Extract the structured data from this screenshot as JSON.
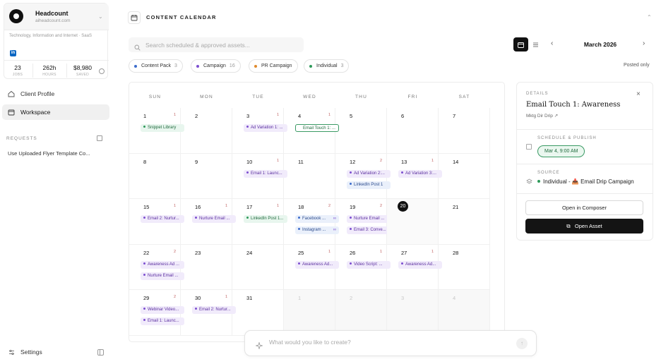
{
  "org": {
    "name": "Headcount",
    "domain": "aiheadcount.com",
    "industry": "Technology, Information and Internet · SaaS",
    "linkedin_badge": "in",
    "stats": [
      {
        "value": "23",
        "label": "JOBS"
      },
      {
        "value": "262h",
        "label": "HOURS"
      },
      {
        "value": "$8,980",
        "label": "SAVED"
      }
    ]
  },
  "nav": {
    "items": [
      {
        "label": "Client Profile",
        "icon": "home-icon",
        "active": false
      },
      {
        "label": "Workspace",
        "icon": "calendar-icon",
        "active": true
      }
    ]
  },
  "requests": {
    "label": "REQUESTS",
    "items": [
      "Use Uploaded Flyer Template Co..."
    ]
  },
  "settings_label": "Settings",
  "header": {
    "title": "CONTENT CALENDAR"
  },
  "search": {
    "placeholder": "Search scheduled & approved assets..."
  },
  "month": {
    "label": "March 2026",
    "prev": "‹",
    "next": "›"
  },
  "filters": [
    {
      "label": "Content Pack",
      "count": "3",
      "color": "#3c6ccc"
    },
    {
      "label": "Campaign",
      "count": "16",
      "color": "#7d4fd0"
    },
    {
      "label": "PR Campaign",
      "count": "",
      "color": "#e08a2c"
    },
    {
      "label": "Individual",
      "count": "3",
      "color": "#2e9a5a"
    }
  ],
  "posted_only": "Posted only",
  "weekdays": [
    "SUN",
    "MON",
    "TUE",
    "WED",
    "THU",
    "FRI",
    "SAT"
  ],
  "days": [
    {
      "d": "1",
      "c": "1",
      "events": [
        {
          "t": "Snippet Library",
          "k": "green"
        }
      ]
    },
    {
      "d": "2",
      "c": "",
      "events": []
    },
    {
      "d": "3",
      "c": "1",
      "events": [
        {
          "t": "Ad Variation 1: ...",
          "k": "purple"
        }
      ]
    },
    {
      "d": "4",
      "c": "1",
      "events": [
        {
          "t": "Email Touch 1: ...",
          "k": "selected"
        }
      ]
    },
    {
      "d": "5",
      "c": "",
      "events": []
    },
    {
      "d": "6",
      "c": "",
      "events": []
    },
    {
      "d": "7",
      "c": "",
      "events": []
    },
    {
      "d": "8",
      "c": "",
      "events": []
    },
    {
      "d": "9",
      "c": "",
      "events": []
    },
    {
      "d": "10",
      "c": "1",
      "events": [
        {
          "t": "Email 1: Launc...",
          "k": "purple"
        }
      ]
    },
    {
      "d": "11",
      "c": "",
      "events": []
    },
    {
      "d": "12",
      "c": "2",
      "events": [
        {
          "t": "Ad Variation 2:...",
          "k": "purple"
        },
        {
          "t": "LinkedIn Post 1",
          "k": "blue"
        }
      ]
    },
    {
      "d": "13",
      "c": "1",
      "events": [
        {
          "t": "Ad Variation 3:...",
          "k": "purple"
        }
      ]
    },
    {
      "d": "14",
      "c": "",
      "events": []
    },
    {
      "d": "15",
      "c": "1",
      "events": [
        {
          "t": "Email 2: Nurtur...",
          "k": "purple"
        }
      ]
    },
    {
      "d": "16",
      "c": "1",
      "events": [
        {
          "t": "Nurture Email ...",
          "k": "purple"
        }
      ]
    },
    {
      "d": "17",
      "c": "1",
      "events": [
        {
          "t": "LinkedIn Post 1...",
          "k": "green"
        }
      ]
    },
    {
      "d": "18",
      "c": "2",
      "events": [
        {
          "t": "Facebook ...",
          "k": "blue",
          "more": "∞"
        },
        {
          "t": "Instagram ...",
          "k": "blue",
          "more": "∞"
        }
      ]
    },
    {
      "d": "19",
      "c": "2",
      "events": [
        {
          "t": "Nurture Email ...",
          "k": "purple"
        },
        {
          "t": "Email 3: Conve...",
          "k": "purple"
        }
      ]
    },
    {
      "d": "20",
      "c": "",
      "events": [],
      "today": true
    },
    {
      "d": "21",
      "c": "",
      "events": []
    },
    {
      "d": "22",
      "c": "2",
      "events": [
        {
          "t": "Awareness Ad ...",
          "k": "purple"
        },
        {
          "t": "Nurture Email ...",
          "k": "purple"
        }
      ]
    },
    {
      "d": "23",
      "c": "",
      "events": []
    },
    {
      "d": "24",
      "c": "",
      "events": []
    },
    {
      "d": "25",
      "c": "1",
      "events": [
        {
          "t": "Awareness Ad...",
          "k": "purple"
        }
      ]
    },
    {
      "d": "26",
      "c": "1",
      "events": [
        {
          "t": "Video Script: ...",
          "k": "purple"
        }
      ]
    },
    {
      "d": "27",
      "c": "1",
      "events": [
        {
          "t": "Awareness Ad...",
          "k": "purple"
        }
      ]
    },
    {
      "d": "28",
      "c": "",
      "events": []
    },
    {
      "d": "29",
      "c": "2",
      "events": [
        {
          "t": "Webinar Video...",
          "k": "purple"
        },
        {
          "t": "Email 1: Launc...",
          "k": "purple"
        }
      ]
    },
    {
      "d": "30",
      "c": "1",
      "events": [
        {
          "t": "Email 2: Nurtur...",
          "k": "purple"
        }
      ]
    },
    {
      "d": "31",
      "c": "",
      "events": []
    },
    {
      "d": "1",
      "c": "",
      "events": [],
      "out": true
    },
    {
      "d": "2",
      "c": "",
      "events": [],
      "out": true
    },
    {
      "d": "3",
      "c": "",
      "events": [],
      "out": true
    },
    {
      "d": "4",
      "c": "",
      "events": [],
      "out": true
    }
  ],
  "details": {
    "label": "DETAILS",
    "title": "Email Touch 1: Awareness",
    "subtitle": "Mktg Dir Drip",
    "schedule_label": "SCHEDULE & PUBLISH",
    "schedule_value": "Mar 4, 9:00 AM",
    "source_label": "SOURCE",
    "source_value": "Individual - 📥 Email Drip Campaign",
    "composer_button": "Open in Composer",
    "open_button": "Open Asset"
  },
  "prompt": {
    "placeholder": "What would you like to create?",
    "send": "↑"
  }
}
